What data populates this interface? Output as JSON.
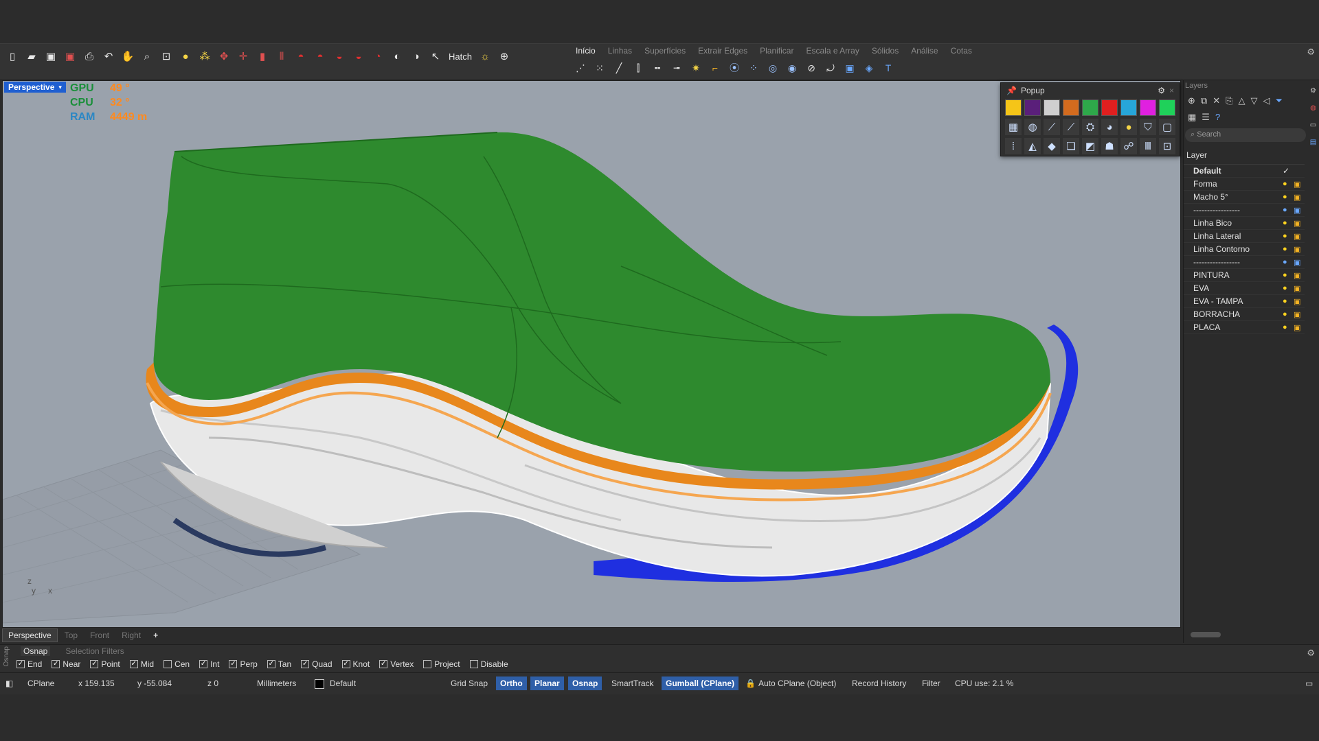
{
  "toolbar": {
    "hatch_label": "Hatch",
    "tabs": [
      "Início",
      "Linhas",
      "Superfícies",
      "Extrair Edges",
      "Planificar",
      "Escala e Array",
      "Sólidos",
      "Análise",
      "Cotas"
    ]
  },
  "viewport": {
    "name": "Perspective",
    "stats": {
      "gpu_label": "GPU",
      "gpu_value": "49 °",
      "cpu_label": "CPU",
      "cpu_value": "32 °",
      "ram_label": "RAM",
      "ram_value": "4449 m"
    },
    "axis_z": "z",
    "axis_y": "y",
    "axis_x": "x"
  },
  "popup": {
    "title": "Popup",
    "swatches": [
      "#f5c518",
      "#5a1f7a",
      "#cfcfcf",
      "#d36b1e",
      "#2ea84a",
      "#e01f1f",
      "#27a6d9",
      "#e020e0",
      "#1fd15a"
    ]
  },
  "layers": {
    "panel_title": "Layers",
    "search_placeholder": "Search",
    "column_header": "Layer",
    "items": [
      {
        "name": "Default",
        "current": true
      },
      {
        "name": "Forma"
      },
      {
        "name": "Macho 5°"
      },
      {
        "name": "-----------------",
        "dim": true
      },
      {
        "name": "Linha Bico"
      },
      {
        "name": "Linha Lateral"
      },
      {
        "name": "Linha Contorno"
      },
      {
        "name": "-----------------",
        "dim": true
      },
      {
        "name": "PINTURA"
      },
      {
        "name": "EVA"
      },
      {
        "name": "EVA - TAMPA"
      },
      {
        "name": "BORRACHA"
      },
      {
        "name": "PLACA"
      }
    ]
  },
  "viewport_tabs": [
    "Perspective",
    "Top",
    "Front",
    "Right",
    "+"
  ],
  "osnap": {
    "tabs": [
      "Osnap",
      "Selection Filters"
    ],
    "vertical_label": "Osnap",
    "options": [
      {
        "label": "End",
        "checked": true
      },
      {
        "label": "Near",
        "checked": true
      },
      {
        "label": "Point",
        "checked": true
      },
      {
        "label": "Mid",
        "checked": true
      },
      {
        "label": "Cen",
        "checked": false
      },
      {
        "label": "Int",
        "checked": true
      },
      {
        "label": "Perp",
        "checked": true
      },
      {
        "label": "Tan",
        "checked": true
      },
      {
        "label": "Quad",
        "checked": true
      },
      {
        "label": "Knot",
        "checked": true
      },
      {
        "label": "Vertex",
        "checked": true
      },
      {
        "label": "Project",
        "checked": false
      },
      {
        "label": "Disable",
        "checked": false
      }
    ]
  },
  "status": {
    "cplane": "CPlane",
    "x": "x 159.135",
    "y": "y -55.084",
    "z": "z 0",
    "units": "Millimeters",
    "layer": "Default",
    "grid_snap": "Grid Snap",
    "ortho": "Ortho",
    "planar": "Planar",
    "osnap": "Osnap",
    "smarttrack": "SmartTrack",
    "gumball": "Gumball (CPlane)",
    "auto_cplane": "Auto CPlane (Object)",
    "record_history": "Record History",
    "filter": "Filter",
    "cpu_use": "CPU use: 2.1 %"
  }
}
